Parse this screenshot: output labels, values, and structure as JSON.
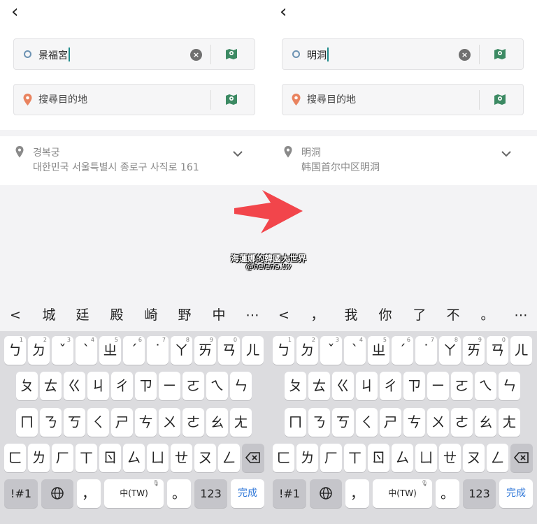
{
  "left": {
    "origin": "景福宮",
    "destination_placeholder": "搜尋目的地",
    "result_title": "경복궁",
    "result_subtitle": "대한민국 서울특별시 종로구 사직로 161",
    "candidates": [
      "城",
      "廷",
      "殿",
      "崎",
      "野",
      "中"
    ]
  },
  "right": {
    "origin": "明洞",
    "destination_placeholder": "搜尋目的地",
    "result_title": "明洞",
    "result_subtitle": "韩国首尔中区明洞",
    "candidates": [
      "，",
      "我",
      "你",
      "了",
      "不",
      "。"
    ]
  },
  "candidate_back": "<",
  "candidate_more": "⋯",
  "keyboard": {
    "row1": [
      "ㄅ",
      "ㄉ",
      "ˇ",
      "ˋ",
      "ㄓ",
      "ˊ",
      "˙",
      "ㄚ",
      "ㄞ",
      "ㄢ",
      "ㄦ"
    ],
    "row1_nums": [
      "1",
      "2",
      "3",
      "4",
      "5",
      "6",
      "7",
      "8",
      "9",
      "0",
      ""
    ],
    "row2": [
      "ㄆ",
      "ㄊ",
      "ㄍ",
      "ㄐ",
      "ㄔ",
      "ㄗ",
      "ㄧ",
      "ㄛ",
      "ㄟ",
      "ㄣ"
    ],
    "row3": [
      "ㄇ",
      "ㄋ",
      "ㄎ",
      "ㄑ",
      "ㄕ",
      "ㄘ",
      "ㄨ",
      "ㄜ",
      "ㄠ",
      "ㄤ"
    ],
    "row4": [
      "ㄈ",
      "ㄌ",
      "ㄏ",
      "ㄒ",
      "ㄖ",
      "ㄙ",
      "ㄩ",
      "ㄝ",
      "ㄡ",
      "ㄥ"
    ],
    "symbols_key": "!#1",
    "comma_key": "，",
    "space_key": "中(TW)",
    "period_key": "。",
    "numbers_key": "123",
    "done_key": "完成"
  },
  "watermark": {
    "line1": "海蓮娜的韓國大世界",
    "line2": "@helena.tw"
  },
  "colors": {
    "arrow": "#f2454b",
    "accent": "#1f8a8a",
    "done": "#2f77d8"
  }
}
